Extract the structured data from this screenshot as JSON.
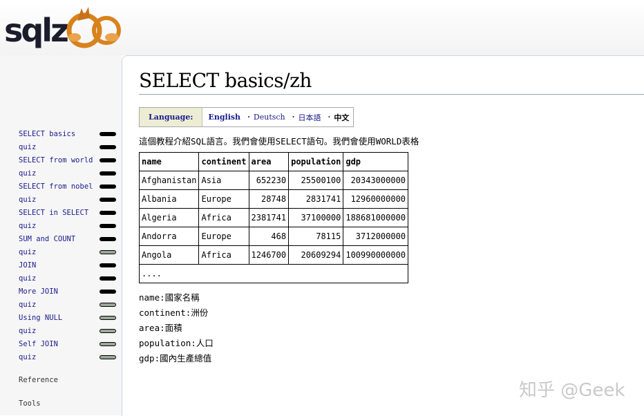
{
  "site": {
    "logo_text": "SQLZOO"
  },
  "sidebar": {
    "items": [
      {
        "label": "SELECT basics",
        "pill": "dark"
      },
      {
        "label": "quiz",
        "pill": "dark"
      },
      {
        "label": "SELECT from world",
        "pill": "dark"
      },
      {
        "label": "quiz",
        "pill": "dark"
      },
      {
        "label": "SELECT from nobel",
        "pill": "dark"
      },
      {
        "label": "quiz",
        "pill": "dark"
      },
      {
        "label": "SELECT in SELECT",
        "pill": "dark"
      },
      {
        "label": "quiz",
        "pill": "dark"
      },
      {
        "label": "SUM and COUNT",
        "pill": "dark"
      },
      {
        "label": "quiz",
        "pill": "light"
      },
      {
        "label": "JOIN",
        "pill": "dark"
      },
      {
        "label": "quiz",
        "pill": "dark"
      },
      {
        "label": "More JOIN",
        "pill": "dark"
      },
      {
        "label": "quiz",
        "pill": "light"
      },
      {
        "label": "Using NULL",
        "pill": "light"
      },
      {
        "label": "quiz",
        "pill": "light"
      },
      {
        "label": "Self JOIN",
        "pill": "light"
      },
      {
        "label": "quiz",
        "pill": "light"
      }
    ],
    "reference": "Reference",
    "tools": "Tools"
  },
  "main": {
    "title": "SELECT basics/zh",
    "language_bar": {
      "label": "Language:",
      "items": [
        {
          "label": "English",
          "style": "bold-link"
        },
        {
          "label": "Deutsch",
          "style": "link"
        },
        {
          "label": "日本語",
          "style": "link"
        },
        {
          "label": "中文",
          "style": "current"
        }
      ],
      "separator": "·"
    },
    "intro": "這個教程介紹SQL語言。我們會使用SELECT語句。我們會使用WORLD表格",
    "table": {
      "columns": [
        "name",
        "continent",
        "area",
        "population",
        "gdp"
      ],
      "rows": [
        [
          "Afghanistan",
          "Asia",
          "652230",
          "25500100",
          "20343000000"
        ],
        [
          "Albania",
          "Europe",
          "28748",
          "2831741",
          "12960000000"
        ],
        [
          "Algeria",
          "Africa",
          "2381741",
          "37100000",
          "188681000000"
        ],
        [
          "Andorra",
          "Europe",
          "468",
          "78115",
          "3712000000"
        ],
        [
          "Angola",
          "Africa",
          "1246700",
          "20609294",
          "100990000000"
        ]
      ],
      "ellipsis": "...."
    },
    "descriptions": [
      "name:國家名稱",
      "continent:洲份",
      "area:面積",
      "population:人口",
      "gdp:國內生產總值"
    ]
  },
  "watermark": "知乎 @Geek",
  "colors": {
    "link": "#1a1a8c",
    "language_label_bg": "#ededd4",
    "pill_dark": "#000000",
    "pill_light": "#9aa89a"
  }
}
